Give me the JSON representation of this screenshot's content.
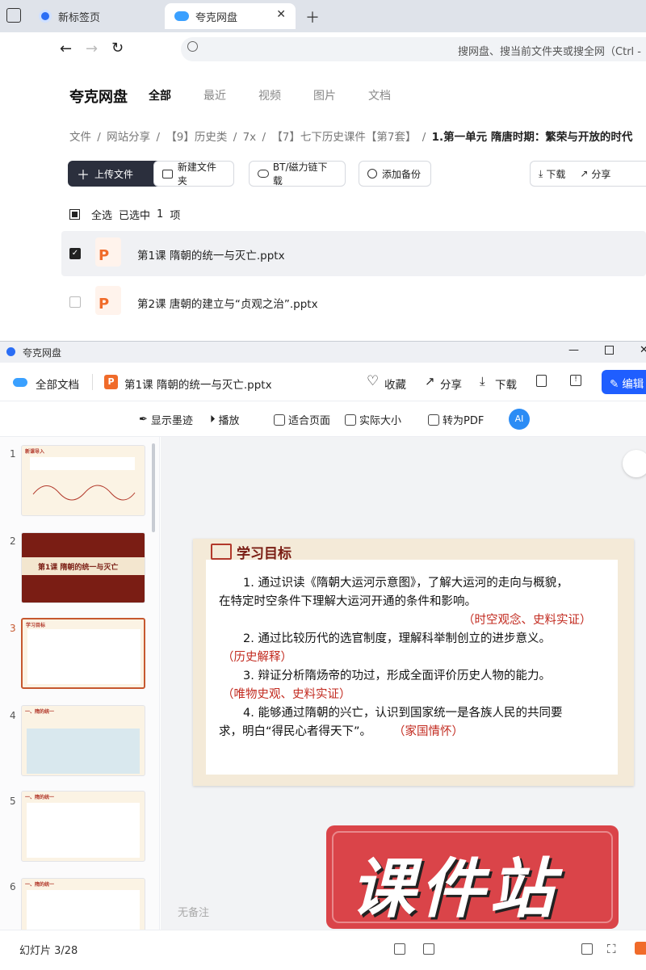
{
  "browser": {
    "tabs": [
      {
        "label": "新标签页"
      },
      {
        "label": "夸克网盘"
      }
    ],
    "address_placeholder": "搜网盘、搜当前文件夹或搜全网（Ctrl -"
  },
  "drive": {
    "brand": "夸克网盘",
    "nav": [
      "全部",
      "最近",
      "视频",
      "图片",
      "文档"
    ],
    "breadcrumb": [
      "文件",
      "/",
      "网站分享",
      "/",
      "【9】历史类",
      "/",
      "7x",
      "/",
      "【7】七下历史课件【第7套】",
      "/",
      "1.第一单元 隋唐时期：繁荣与开放的时代"
    ],
    "actions": {
      "upload": "上传文件",
      "new_folder": "新建文件夹",
      "bt": "BT/磁力链下载",
      "add_backup": "添加备份",
      "download": "下载",
      "share": "分享"
    },
    "selection": {
      "select_all": "全选",
      "selected": "已选中",
      "count": "1",
      "unit": "项"
    },
    "files": [
      {
        "name": "第1课 隋朝的统一与灭亡.pptx",
        "checked": true
      },
      {
        "name": "第2课  唐朝的建立与“贞观之治”.pptx",
        "checked": false
      }
    ]
  },
  "viewer": {
    "window_title": "夸克网盘",
    "all_docs": "全部文档",
    "file_name": "第1课 隋朝的统一与灭亡.pptx",
    "actions": {
      "favorite": "收藏",
      "share": "分享",
      "download": "下载",
      "edit": "编辑"
    },
    "tools": [
      "显示墨迹",
      "播放",
      "适合页面",
      "实际大小",
      "转为PDF"
    ],
    "thumb_numbers": [
      "1",
      "2",
      "3",
      "4",
      "5",
      "6"
    ],
    "thumb_titles": [
      "新课导入",
      "第1课 隋朝的统一与灭亡",
      "学习目标",
      "一、隋的统一",
      "一、隋的统一",
      "一、隋的统一"
    ],
    "status": "幻灯片 3/28",
    "notes_placeholder": "无备注",
    "watermark": "课件站",
    "slide": {
      "heading": "学习目标",
      "lines": [
        "1. 通过识读《隋朝大运河示意图》，了解大运河的走向与概貌，",
        "在特定时空条件下理解大运河开通的条件和影响。",
        "（时空观念、史料实证）",
        "2. 通过比较历代的选官制度，理解科举制创立的进步意义。",
        "（历史解释）",
        "3. 辩证分析隋炀帝的功过，形成全面评价历史人物的能力。",
        "（唯物史观、史料实证）",
        "4. 能够通过隋朝的兴亡，认识到国家统一是各族人民的共同要",
        "求，明白“得民心者得天下”。",
        "（家国情怀）"
      ]
    }
  },
  "colors": {
    "accent": "#1f5eff",
    "brand_red": "#c22a1f",
    "upload_btn": "#2b2f3d"
  }
}
